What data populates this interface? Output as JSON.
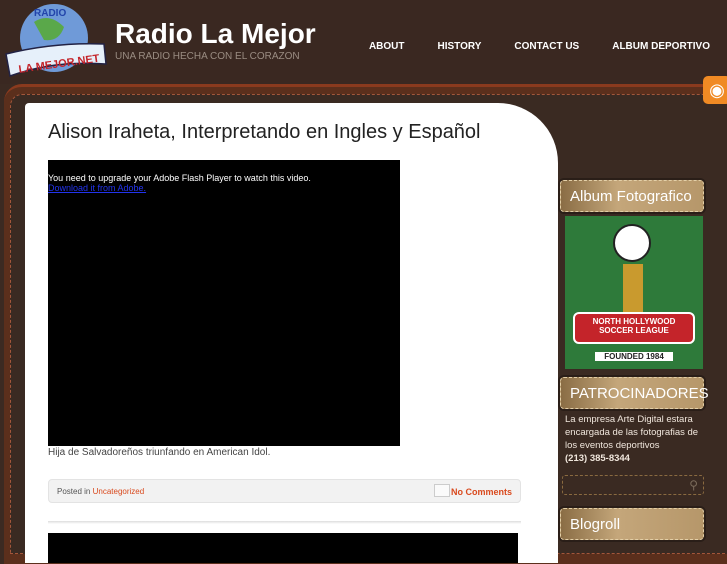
{
  "header": {
    "logo_text": "RADIO LA MEJOR.NET",
    "title": "Radio La Mejor",
    "tagline": "UNA RADIO HECHA CON EL CORAZON"
  },
  "nav": [
    "ABOUT",
    "HISTORY",
    "CONTACT US",
    "ALBUM DEPORTIVO"
  ],
  "post": {
    "title": "Alison Iraheta, Interpretando en Ingles y Español",
    "flash_msg": "You need to upgrade your Adobe Flash Player to watch this video.",
    "flash_link": "Download it from Adobe.",
    "caption": "Hija de Salvadoreños triunfando en American Idol.",
    "posted_in": "Posted in",
    "category": "Uncategorized",
    "comments": "No Comments"
  },
  "sidebar": {
    "album_title": "Album Fotografico",
    "album_image_text": {
      "banner": "NORTH HOLLYWOOD SOCCER LEAGUE",
      "founded": "FOUNDED 1984"
    },
    "sponsors_title": "PATROCINADORES",
    "sponsors_text": "La empresa Arte Digital estara encargada de las fotografias de los eventos deportivos",
    "sponsors_phone": "(213) 385-8344",
    "blogroll_title": "Blogroll"
  }
}
